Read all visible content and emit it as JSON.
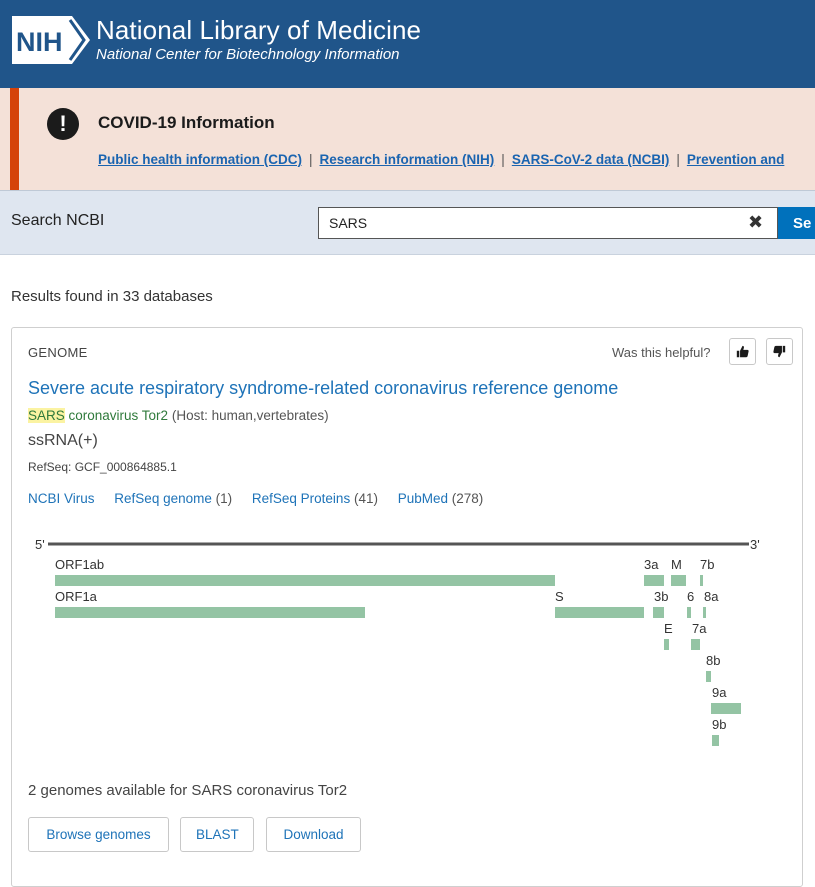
{
  "header": {
    "logo_text": "NIH",
    "title": "National Library of Medicine",
    "subtitle": "National Center for Biotechnology Information"
  },
  "covid_banner": {
    "icon": "exclamation-icon",
    "title": "COVID-19 Information",
    "links": [
      "Public health information (CDC)",
      "Research information (NIH)",
      "SARS-CoV-2 data (NCBI)",
      "Prevention and"
    ],
    "separator": "|"
  },
  "search": {
    "label": "Search NCBI",
    "value": "SARS",
    "clear_icon": "close-icon",
    "button_label": "Se"
  },
  "results_count": "Results found in 33 databases",
  "card": {
    "database": "GENOME",
    "helpful_prompt": "Was this helpful?",
    "thumbs_up_icon": "thumbs-up-icon",
    "thumbs_down_icon": "thumbs-down-icon",
    "title": "Severe acute respiratory syndrome-related coronavirus reference genome",
    "organism_highlight": "SARS",
    "organism_rest": " coronavirus Tor2",
    "host": " (Host: human,vertebrates)",
    "molecule_type": "ssRNA(+)",
    "refseq": "RefSeq: GCF_000864885.1",
    "links": [
      {
        "label": "NCBI Virus",
        "count": ""
      },
      {
        "label": "RefSeq genome",
        "count": " (1)"
      },
      {
        "label": "RefSeq Proteins",
        "count": " (41)"
      },
      {
        "label": "PubMed",
        "count": " (278)"
      }
    ],
    "genome_map": {
      "five_prime": "5'",
      "three_prime": "3'",
      "gene_color": "#94c4a4",
      "genes": [
        "ORF1ab",
        "ORF1a",
        "S",
        "3a",
        "3b",
        "E",
        "M",
        "6",
        "7a",
        "7b",
        "8a",
        "8b",
        "9a",
        "9b"
      ]
    },
    "genomes_available": "2 genomes available for SARS coronavirus Tor2",
    "buttons": [
      "Browse genomes",
      "BLAST",
      "Download"
    ]
  }
}
